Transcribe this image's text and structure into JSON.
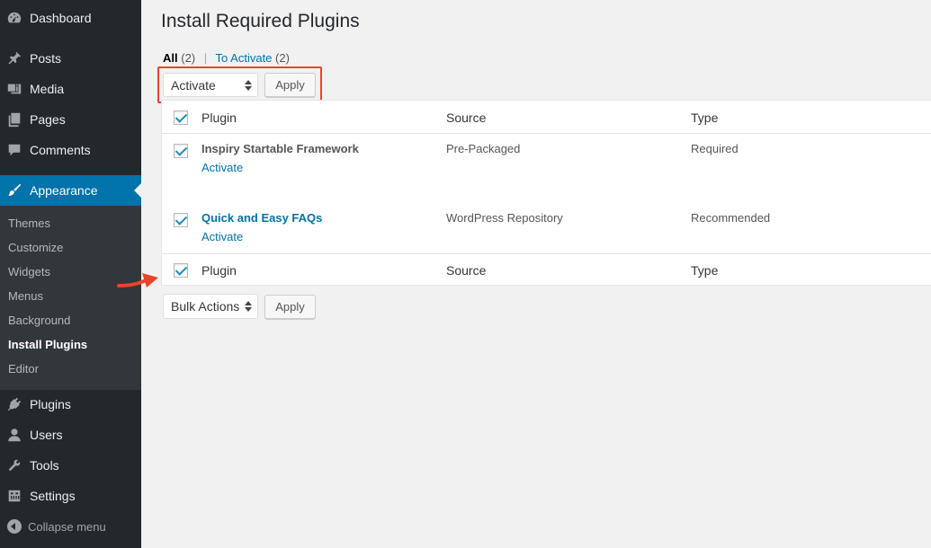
{
  "sidebar": {
    "items": [
      {
        "label": "Dashboard",
        "icon": "dashboard-icon"
      },
      {
        "label": "Posts",
        "icon": "pin-icon"
      },
      {
        "label": "Media",
        "icon": "media-icon"
      },
      {
        "label": "Pages",
        "icon": "pages-icon"
      },
      {
        "label": "Comments",
        "icon": "comment-icon"
      },
      {
        "label": "Appearance",
        "icon": "brush-icon"
      },
      {
        "label": "Plugins",
        "icon": "plug-icon"
      },
      {
        "label": "Users",
        "icon": "user-icon"
      },
      {
        "label": "Tools",
        "icon": "wrench-icon"
      },
      {
        "label": "Settings",
        "icon": "settings-icon"
      }
    ],
    "submenu": [
      "Themes",
      "Customize",
      "Widgets",
      "Menus",
      "Background",
      "Install Plugins",
      "Editor"
    ],
    "collapse_label": "Collapse menu"
  },
  "page": {
    "title": "Install Required Plugins",
    "filters": {
      "all_label": "All",
      "all_count": "(2)",
      "separator": "|",
      "to_activate_label": "To Activate",
      "to_activate_count": "(2)"
    }
  },
  "bulk_top": {
    "selected": "Activate",
    "apply_label": "Apply"
  },
  "bulk_bottom": {
    "selected": "Bulk Actions",
    "apply_label": "Apply"
  },
  "table": {
    "headers": {
      "plugin": "Plugin",
      "source": "Source",
      "type": "Type"
    },
    "rows": [
      {
        "name": "Inspiry Startable Framework",
        "action": "Activate",
        "source": "Pre-Packaged",
        "type": "Required"
      },
      {
        "name": "Quick and Easy FAQs",
        "action": "Activate",
        "source": "WordPress Repository",
        "type": "Recommended"
      }
    ]
  },
  "colors": {
    "sidebar_bg": "#23282d",
    "accent": "#0073aa",
    "highlight": "#e8442b"
  }
}
